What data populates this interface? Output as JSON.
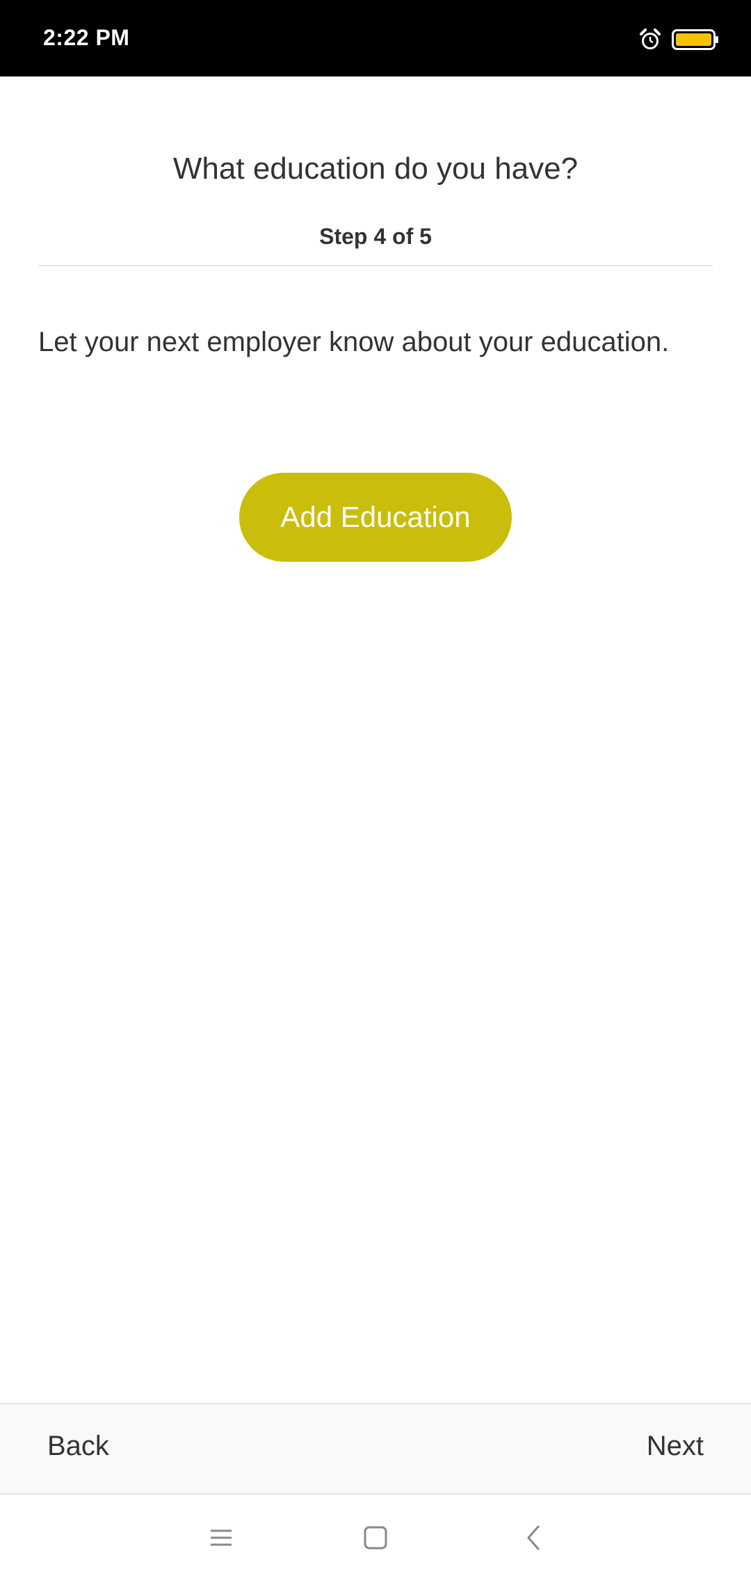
{
  "status_bar": {
    "time": "2:22 PM",
    "icons": [
      "alarm-icon",
      "battery-icon"
    ],
    "battery_color": "#f5c400"
  },
  "header": {
    "title": "What education do you have?",
    "step": "Step 4 of 5"
  },
  "main": {
    "description": "Let your next employer know about your education.",
    "add_button_label": "Add Education",
    "accent_color": "#cbbd0b"
  },
  "footer": {
    "back_label": "Back",
    "next_label": "Next"
  },
  "system_nav": {
    "icons": [
      "menu-icon",
      "home-icon",
      "back-icon"
    ]
  }
}
